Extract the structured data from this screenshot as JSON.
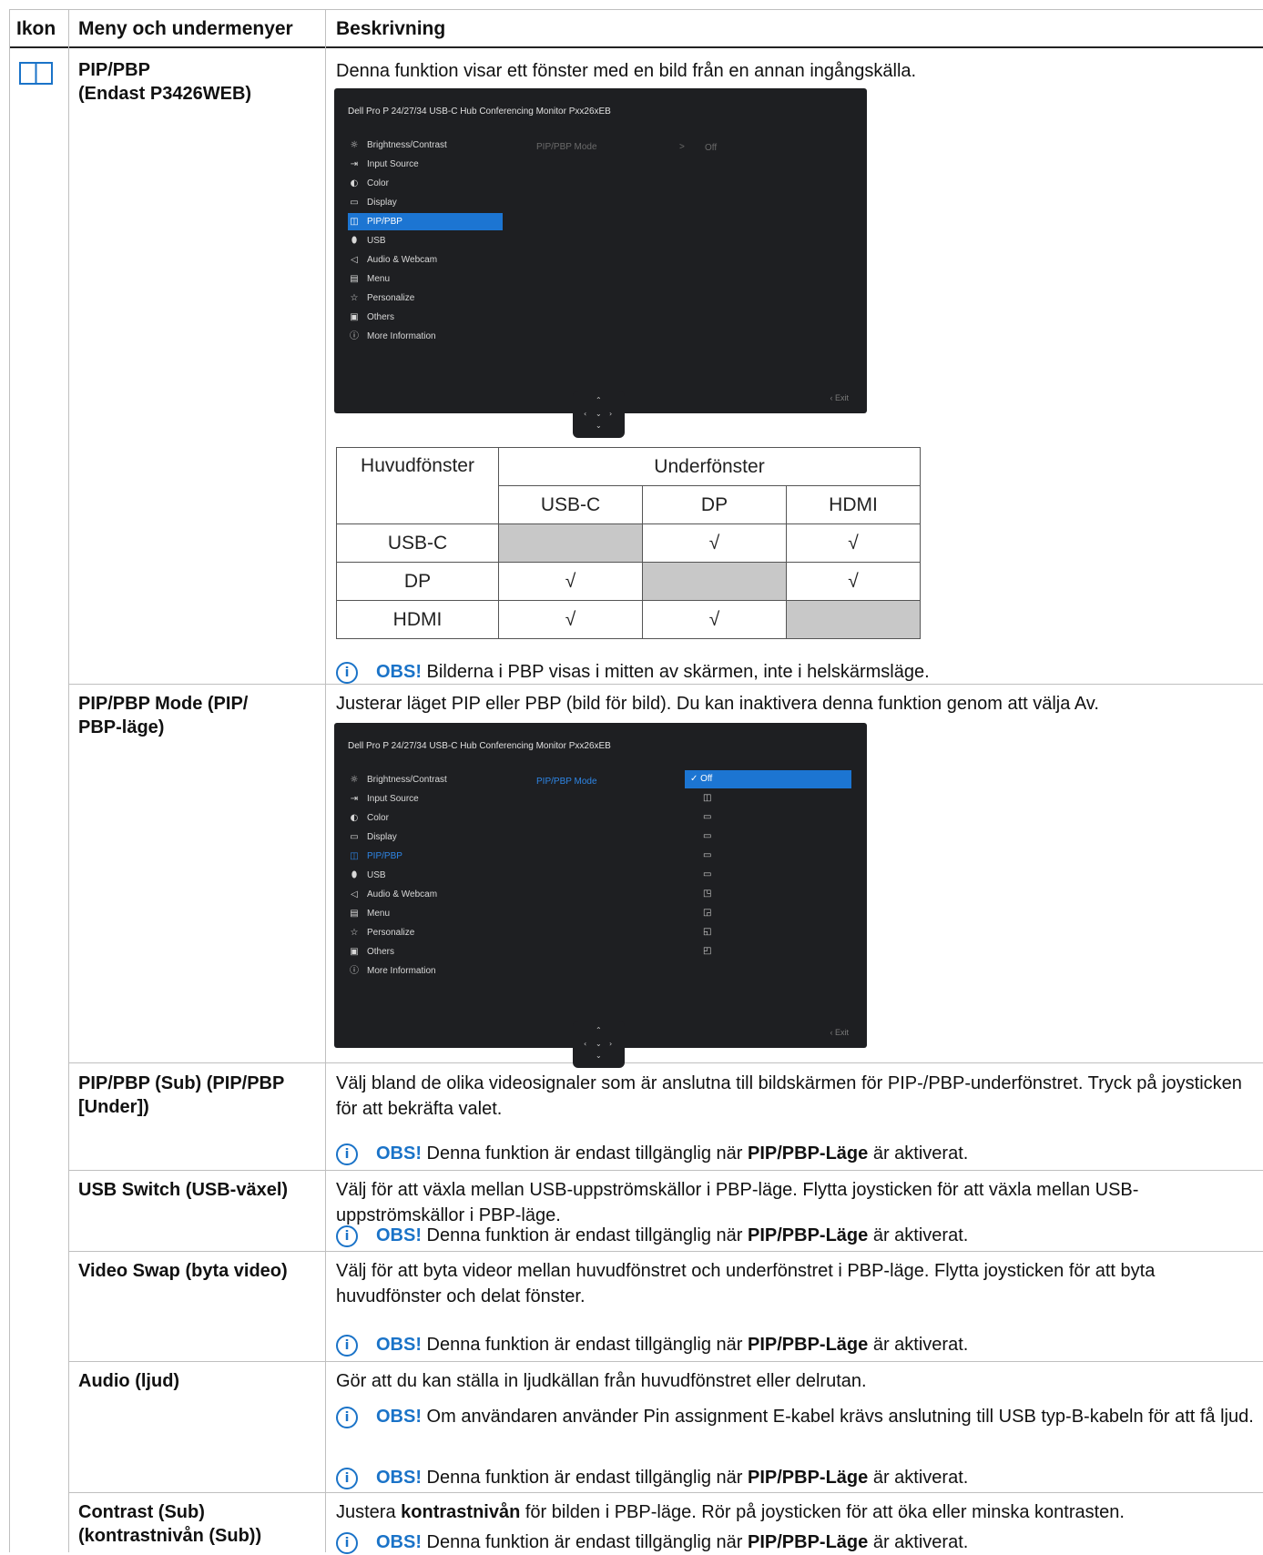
{
  "header": {
    "col_icon": "Ikon",
    "col_menu": "Meny och undermenyer",
    "col_desc": "Beskrivning"
  },
  "rows": {
    "pip": {
      "menu_line1": "PIP/PBP",
      "menu_line2": "(Endast P3426WEB)",
      "desc": "Denna funktion visar ett fönster med en bild från en annan ingångskälla.",
      "note_obs": "OBS!",
      "note_text": " Bilderna i PBP visas i mitten av skärmen, inte i helskärmsläge."
    },
    "mode": {
      "menu_line1": "PIP/PBP Mode (PIP/",
      "menu_line2": "PBP-läge)",
      "desc": "Justerar läget PIP eller PBP (bild för bild). Du kan inaktivera denna funktion genom att välja Av."
    },
    "sub": {
      "menu_line1": "PIP/PBP (Sub) (PIP/PBP",
      "menu_line2": "[Under])",
      "desc": "Välj bland de olika videosignaler som är anslutna till bildskärmen för PIP-/PBP-underfönstret. Tryck på joysticken för att bekräfta valet."
    },
    "usb": {
      "menu": "USB Switch (USB-växel)",
      "desc": "Välj för att växla mellan USB-uppströmskällor i PBP-läge. Flytta joysticken för att växla mellan USB-uppströmskällor i PBP-läge."
    },
    "swap": {
      "menu": "Video Swap (byta video)",
      "desc": "Välj för att byta videor mellan huvudfönstret och underfönstret i PBP-läge. Flytta joysticken för att byta huvudfönster och delat fönster."
    },
    "audio": {
      "menu": "Audio (ljud)",
      "desc": "Gör att du kan ställa in ljudkällan från huvudfönstret eller delrutan.",
      "note1_obs": "OBS!",
      "note1_text": " Om användaren använder Pin assignment E-kabel krävs anslutning till USB typ-B-kabeln för att få ljud."
    },
    "contrast": {
      "menu_line1": "Contrast (Sub)",
      "menu_line2": "(kontrastnivån (Sub))",
      "desc_pre": "Justera ",
      "desc_bold": "kontrastnivån",
      "desc_post": " för bilden i PBP-läge. Rör på joysticken för att öka eller minska kontrasten."
    }
  },
  "common_note": {
    "obs": "OBS!",
    "pre": " Denna funktion är endast tillgänglig när ",
    "bold": "PIP/PBP-Läge",
    "post": " är aktiverat."
  },
  "osd": {
    "title": "Dell Pro P 24/27/34 USB-C Hub Conferencing Monitor  Pxx26xEB",
    "menu": [
      "Brightness/Contrast",
      "Input Source",
      "Color",
      "Display",
      "PIP/PBP",
      "USB",
      "Audio & Webcam",
      "Menu",
      "Personalize",
      "Others",
      "More Information"
    ],
    "mode_label": "PIP/PBP Mode",
    "chevron": ">",
    "off": "Off",
    "exit": "‹ Exit",
    "check_off": "✓ Off"
  },
  "compat_table": {
    "main_header": "Huvudfönster",
    "sub_header": "Underfönster",
    "columns": [
      "USB-C",
      "DP",
      "HDMI"
    ],
    "rows": [
      {
        "name": "USB-C",
        "cells": [
          "",
          "√",
          "√"
        ]
      },
      {
        "name": "DP",
        "cells": [
          "√",
          "",
          "√"
        ]
      },
      {
        "name": "HDMI",
        "cells": [
          "√",
          "√",
          ""
        ]
      }
    ]
  },
  "colors": {
    "accent": "#1a73c8",
    "osd_bg": "#1e1f22",
    "osd_select": "#1c75d2",
    "table_gray": "#c8c8c8"
  }
}
